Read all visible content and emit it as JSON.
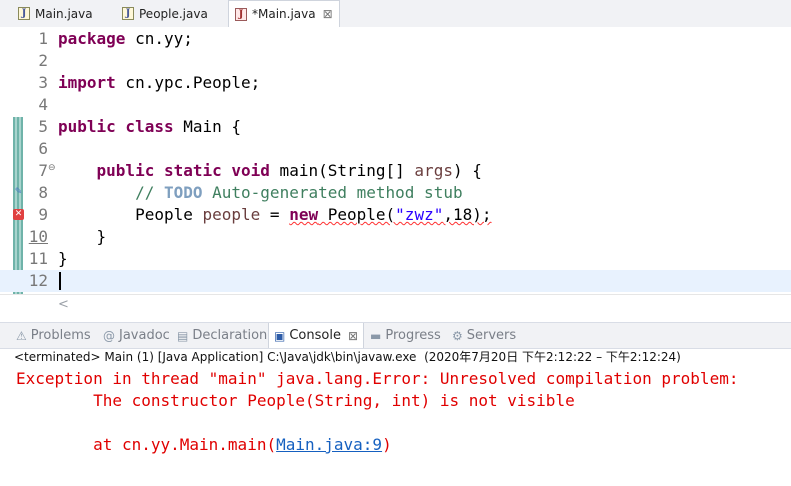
{
  "editor_tabs": [
    {
      "label": "Main.java",
      "active": false
    },
    {
      "label": "People.java",
      "active": false
    },
    {
      "label": "*Main.java",
      "active": true
    }
  ],
  "tab_close_glyph": "⊠",
  "editor": {
    "line_numbers": [
      "1",
      "2",
      "3",
      "4",
      "5",
      "6",
      "7",
      "8",
      "9",
      "10",
      "11",
      "12"
    ],
    "line1": {
      "kw": "package",
      "rest": " cn.yy;"
    },
    "line3": {
      "kw": "import",
      "rest": " cn.ypc.People;"
    },
    "line5": {
      "kw": "public class",
      "rest": " Main {"
    },
    "line7": {
      "indent": "    ",
      "kw": "public static void",
      "rest1": " main(String[] ",
      "var": "args",
      "rest2": ") {"
    },
    "line8": {
      "indent": "        ",
      "comment1": "// ",
      "todo": "TODO",
      "comment2": " Auto-generated method stub"
    },
    "line9": {
      "indent": "        ",
      "type": "People ",
      "var": "people",
      "assign": " = ",
      "kw_new": "new",
      "call_open": " People(",
      "str": "\"zwz\"",
      "rest": ",18);"
    },
    "line10": {
      "text": "    }"
    },
    "line11": {
      "text": "}"
    },
    "scroll_arrow": "<"
  },
  "view_tabs": [
    {
      "label": "Problems",
      "icon": "problems-icon",
      "active": false
    },
    {
      "label": "Javadoc",
      "icon": "at-icon",
      "active": false
    },
    {
      "label": "Declaration",
      "icon": "declaration-icon",
      "active": false
    },
    {
      "label": "Console",
      "icon": "console-icon",
      "active": true
    },
    {
      "label": "Progress",
      "icon": "progress-icon",
      "active": false
    },
    {
      "label": "Servers",
      "icon": "servers-icon",
      "active": false
    }
  ],
  "console": {
    "header": "<terminated> Main (1) [Java Application] C:\\Java\\jdk\\bin\\javaw.exe  (2020年7月20日 下午2:12:22 – 下午2:12:24)",
    "line1": "Exception in thread \"main\" java.lang.Error: Unresolved compilation problem: ",
    "line2": "\tThe constructor People(String, int) is not visible",
    "line3": "",
    "line4_prefix": "\tat cn.yy.Main.main(",
    "line4_link": "Main.java:9",
    "line4_suffix": ")"
  },
  "colors": {
    "keyword": "#7f0055",
    "comment": "#3f7f5f",
    "string": "#2a00ff",
    "error": "#e00000",
    "link": "#1560c0"
  }
}
